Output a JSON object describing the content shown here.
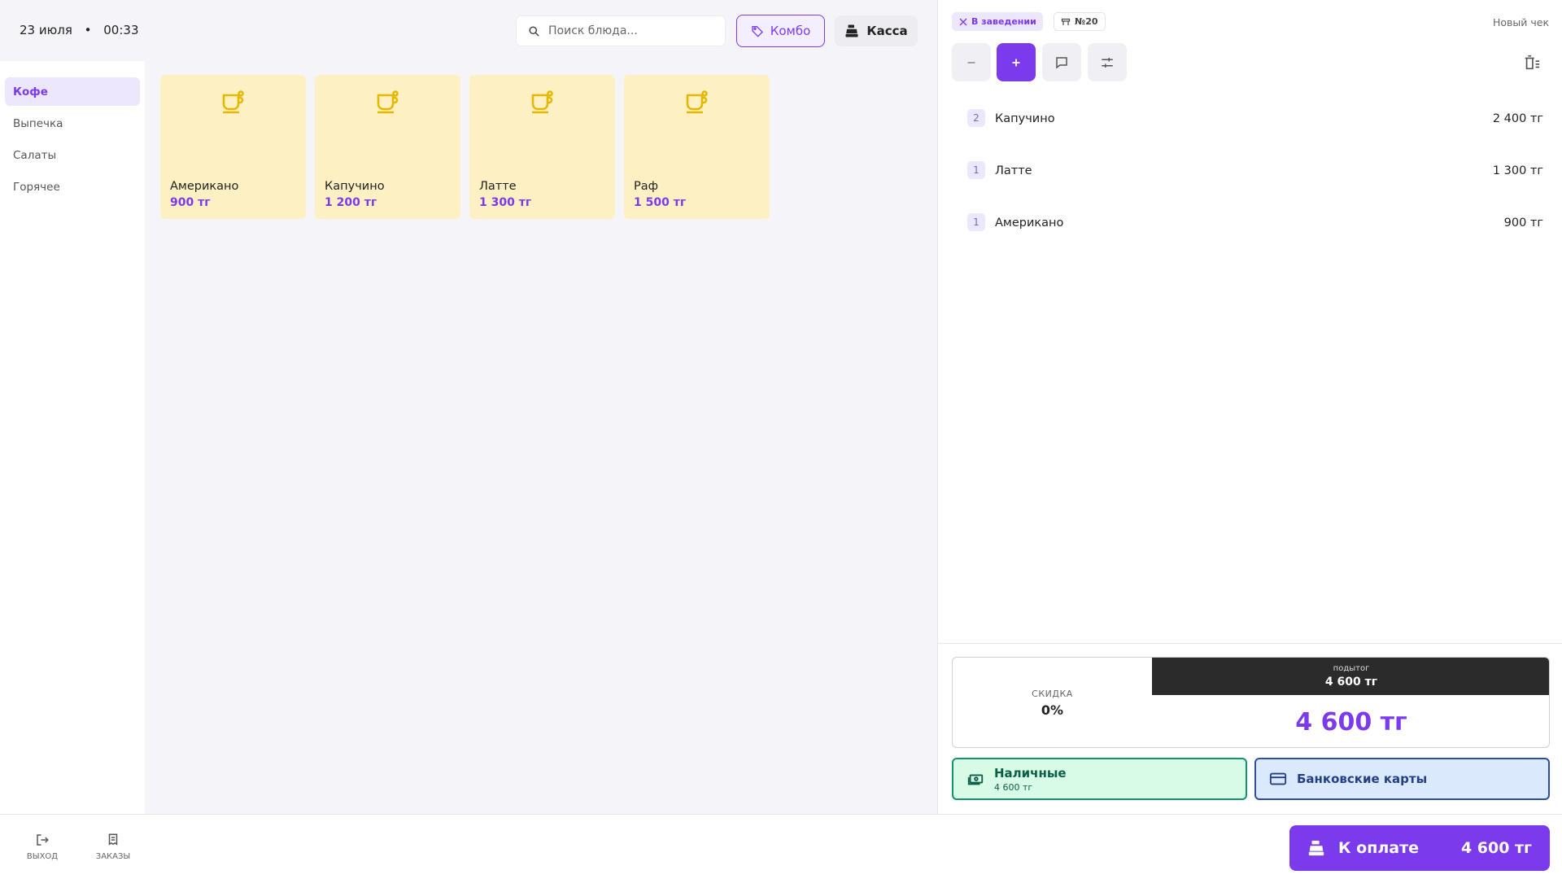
{
  "header": {
    "date": "23 июля",
    "separator": "•",
    "time": "00:33",
    "search_placeholder": "Поиск блюда...",
    "combo_label": "Комбо",
    "kassa_label": "Касса"
  },
  "categories": [
    {
      "label": "Кофе",
      "active": true
    },
    {
      "label": "Выпечка",
      "active": false
    },
    {
      "label": "Салаты",
      "active": false
    },
    {
      "label": "Горячее",
      "active": false
    }
  ],
  "menu_items": [
    {
      "name": "Американо",
      "price": "900 тг"
    },
    {
      "name": "Капучино",
      "price": "1 200 тг"
    },
    {
      "name": "Латте",
      "price": "1 300 тг"
    },
    {
      "name": "Раф",
      "price": "1 500 тг"
    }
  ],
  "order_panel": {
    "place_badge": "В заведении",
    "table_badge": "№20",
    "new_check": "Новый чек",
    "items": [
      {
        "qty": "2",
        "name": "Капучино",
        "sum": "2 400 тг"
      },
      {
        "qty": "1",
        "name": "Латте",
        "sum": "1 300 тг"
      },
      {
        "qty": "1",
        "name": "Американо",
        "sum": "900 тг"
      }
    ],
    "discount_label": "СКИДКА",
    "discount_value": "0%",
    "subtotal_label": "подытог",
    "subtotal_value": "4 600 тг",
    "total_value": "4 600 тг",
    "cash_label": "Наличные",
    "cash_amount": "4 600 тг",
    "card_label": "Банковские карты"
  },
  "bottom": {
    "exit_label": "ВЫХОД",
    "orders_label": "ЗАКАЗЫ",
    "pay_label": "К оплате",
    "pay_amount": "4 600 тг"
  },
  "colors": {
    "accent": "#7c3aed",
    "card_bg": "#fdf1c4",
    "cup_icon": "#e6b800",
    "cash_bg": "#d8fbe8",
    "card_pay_bg": "#dbe9fd"
  }
}
